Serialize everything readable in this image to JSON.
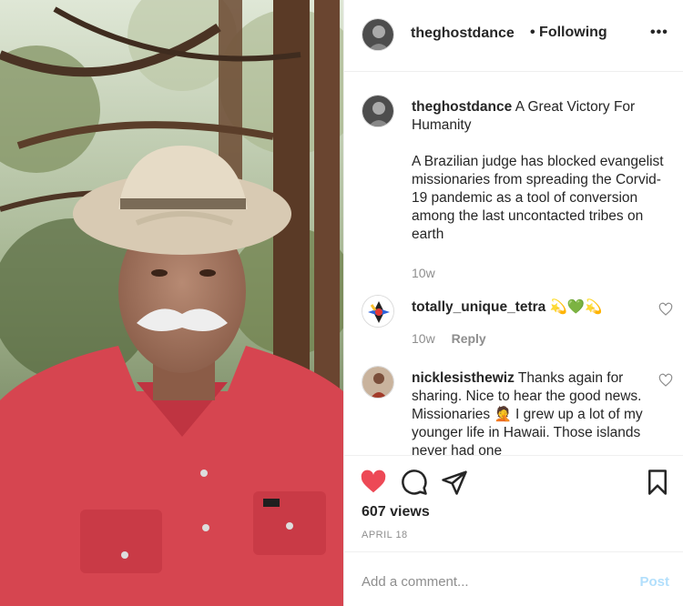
{
  "post": {
    "author": "theghostdance",
    "follow_status": "• Following",
    "more_icon": "more-options-icon",
    "caption_title": "A Great Victory For Humanity",
    "caption_body": "A Brazilian judge has blocked evangelist missionaries from spreading the Corvid-19 pandemic as a tool of conversion among the last uncontacted tribes on earth",
    "caption_time": "10w",
    "views": "607 views",
    "date": "APRIL 18"
  },
  "comments": [
    {
      "username": "totally_unique_tetra",
      "text": "💫💚💫",
      "time": "10w",
      "reply": "Reply"
    },
    {
      "username": "nicklesisthewiz",
      "text": "Thanks again for sharing. Nice to hear the good news. Missionaries 🤦 I grew up a lot of my younger life in Hawaii. Those islands never had one"
    }
  ],
  "composer": {
    "placeholder": "Add a comment...",
    "post_label": "Post"
  },
  "colors": {
    "liked": "#ed4956",
    "post_disabled": "#b2dffc",
    "muted": "#8e8e8e"
  }
}
